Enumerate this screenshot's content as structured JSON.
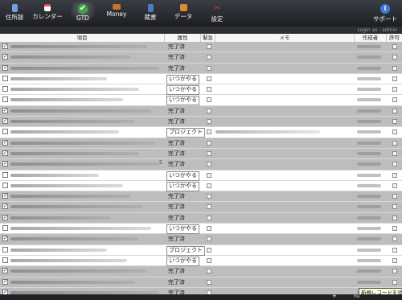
{
  "toolbar": {
    "items": [
      {
        "label": "住所録",
        "icon": "address-book-icon",
        "color": "#6fa0e0"
      },
      {
        "label": "カレンダー",
        "icon": "calendar-icon",
        "color": "#e05050"
      },
      {
        "label": "GTD",
        "icon": "checkmark-icon",
        "color": "#3aa840"
      },
      {
        "label": "Money",
        "icon": "wallet-icon",
        "color": "#c8742c"
      },
      {
        "label": "蔵書",
        "icon": "book-icon",
        "color": "#4c7ac8"
      },
      {
        "label": "データ",
        "icon": "data-icon",
        "color": "#e08a2c"
      },
      {
        "label": "設定",
        "icon": "tools-icon",
        "color": "#c84040"
      },
      {
        "label": "サポート",
        "icon": "info-icon",
        "color": "#3a7ad8"
      }
    ]
  },
  "login_text": "Login as : admin",
  "table": {
    "headers": {
      "item": "項目",
      "attr": "属性",
      "urgent": "緊急",
      "memo": "メモ",
      "author": "作成者",
      "permit": "許可"
    },
    "rows": [
      {
        "checked": true,
        "status": "完了済",
        "bg": "gray"
      },
      {
        "checked": true,
        "status": "完了済",
        "bg": "gray"
      },
      {
        "checked": true,
        "status": "完了済",
        "bg": "gray"
      },
      {
        "checked": false,
        "status": "いつかやる",
        "bg": "white"
      },
      {
        "checked": false,
        "status": "いつかやる",
        "bg": "white"
      },
      {
        "checked": false,
        "status": "いつかやる",
        "bg": "white"
      },
      {
        "checked": true,
        "status": "完了済",
        "bg": "gray"
      },
      {
        "checked": true,
        "status": "完了済",
        "bg": "gray"
      },
      {
        "checked": false,
        "status": "プロジェクト",
        "bg": "white",
        "memo": true
      },
      {
        "checked": true,
        "status": "完了済",
        "bg": "gray"
      },
      {
        "checked": true,
        "status": "完了済",
        "bg": "gray"
      },
      {
        "checked": true,
        "status": "完了済",
        "bg": "gray",
        "stray": "5"
      },
      {
        "checked": false,
        "status": "いつかやる",
        "bg": "white"
      },
      {
        "checked": false,
        "status": "いつかやる",
        "bg": "white"
      },
      {
        "checked": true,
        "status": "完了済",
        "bg": "gray"
      },
      {
        "checked": true,
        "status": "完了済",
        "bg": "gray"
      },
      {
        "checked": true,
        "status": "完了済",
        "bg": "gray"
      },
      {
        "checked": false,
        "status": "いつかやる",
        "bg": "white"
      },
      {
        "checked": true,
        "status": "完了済",
        "bg": "gray"
      },
      {
        "checked": false,
        "status": "プロジェクト",
        "bg": "white"
      },
      {
        "checked": false,
        "status": "いつかやる",
        "bg": "white"
      },
      {
        "checked": true,
        "status": "完了済",
        "bg": "gray"
      },
      {
        "checked": true,
        "status": "完了済",
        "bg": "gray"
      },
      {
        "checked": true,
        "status": "完了済",
        "bg": "gray"
      }
    ]
  },
  "footer": {
    "add_label": "+",
    "right_text": "Re"
  },
  "tooltip": "新規レコードを追加"
}
